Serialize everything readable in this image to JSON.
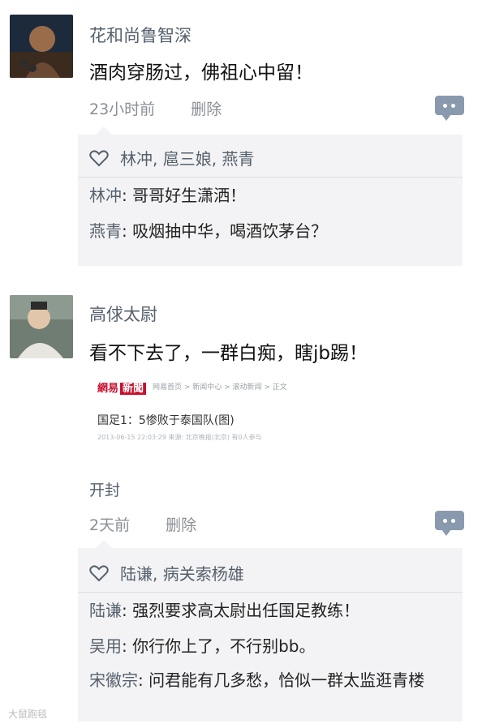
{
  "posts": [
    {
      "author": "花和尚鲁智深",
      "text": "酒肉穿肠过，佛祖心中留！",
      "time": "23小时前",
      "delete_label": "删除",
      "likes": "林冲, 扈三娘, 燕青",
      "replies": [
        {
          "who": "林冲",
          "text": ": 哥哥好生潇洒！"
        },
        {
          "who": "燕青",
          "text": ": 吸烟抽中华，喝酒饮茅台？"
        }
      ]
    },
    {
      "author": "高俅太尉",
      "text": "看不下去了，一群白痴，瞎jb踢！",
      "article": {
        "brand_a": "網易",
        "brand_b": "新聞",
        "crumb": "网易首页 > 新闻中心 > 滚动新闻 > 正文",
        "title": "国足1：5惨败于泰国队(图)",
        "meta_line": "2013-06-15 22:03:29  来源: 北京晚报(北京)  有0人参与"
      },
      "location": "开封",
      "time": "2天前",
      "delete_label": "删除",
      "likes": "陆谦, 病关索杨雄",
      "replies": [
        {
          "who": "陆谦",
          "text": ": 强烈要求高太尉出任国足教练！"
        },
        {
          "who": "吴用",
          "text": ": 你行你上了，不行别bb。"
        },
        {
          "who": "宋徽宗",
          "text": ": 问君能有几多愁，恰似一群太监逛青楼"
        }
      ]
    }
  ],
  "icons": {
    "like": "heart-outline-icon",
    "comment": "comment-bubble-icon"
  },
  "colors": {
    "link": "#56606d",
    "panel_bg": "#f3f3f5",
    "muted": "#8a8f96"
  },
  "watermark": "大鼠跑毯"
}
